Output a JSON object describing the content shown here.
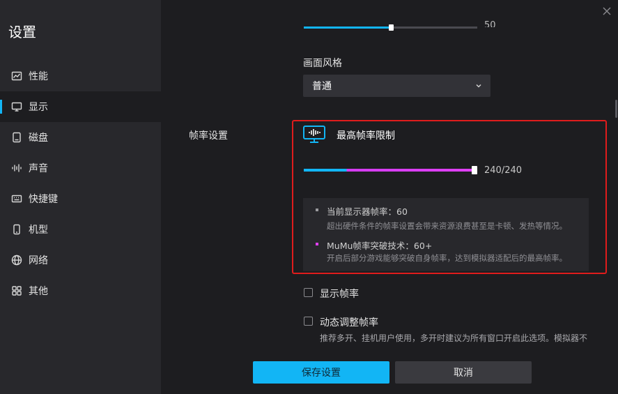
{
  "sidebar": {
    "title": "设置",
    "items": [
      {
        "label": "性能",
        "icon": "chart-icon"
      },
      {
        "label": "显示",
        "icon": "monitor-icon"
      },
      {
        "label": "磁盘",
        "icon": "disk-icon"
      },
      {
        "label": "声音",
        "icon": "sound-icon"
      },
      {
        "label": "快捷键",
        "icon": "keyboard-icon"
      },
      {
        "label": "机型",
        "icon": "phone-icon"
      },
      {
        "label": "网络",
        "icon": "globe-icon"
      },
      {
        "label": "其他",
        "icon": "grid-icon"
      }
    ],
    "active_index": 1
  },
  "display": {
    "top_slider": {
      "value_text": "50",
      "fraction": 0.5
    },
    "style_label": "画面风格",
    "style_select": {
      "value": "普通"
    },
    "fps_section_label": "帧率设置",
    "fps_limit": {
      "title": "最高帧率限制",
      "value_text": "240/240",
      "fraction": 1.0
    },
    "info": [
      {
        "title": "当前显示器帧率：60",
        "desc": "超出硬件条件的帧率设置会带来资源浪费甚至是卡顿、发热等情况。",
        "bullet_color": "#9a9a9e"
      },
      {
        "title": "MuMu帧率突破技术：60+",
        "desc": "开启后部分游戏能够突破自身帧率，达到模拟器适配后的最高帧率。",
        "bullet_color": "#e040f5"
      }
    ],
    "show_fps": {
      "label": "显示帧率",
      "checked": false
    },
    "dynamic_fps": {
      "label": "动态调整帧率",
      "checked": false,
      "desc": "推荐多开、挂机用户使用，多开时建议为所有窗口开启此选项。模拟器不"
    }
  },
  "buttons": {
    "save": "保存设置",
    "cancel": "取消"
  },
  "colors": {
    "accent": "#12b5f5",
    "magenta": "#e040f5",
    "highlight_frame": "#e01c1c"
  }
}
